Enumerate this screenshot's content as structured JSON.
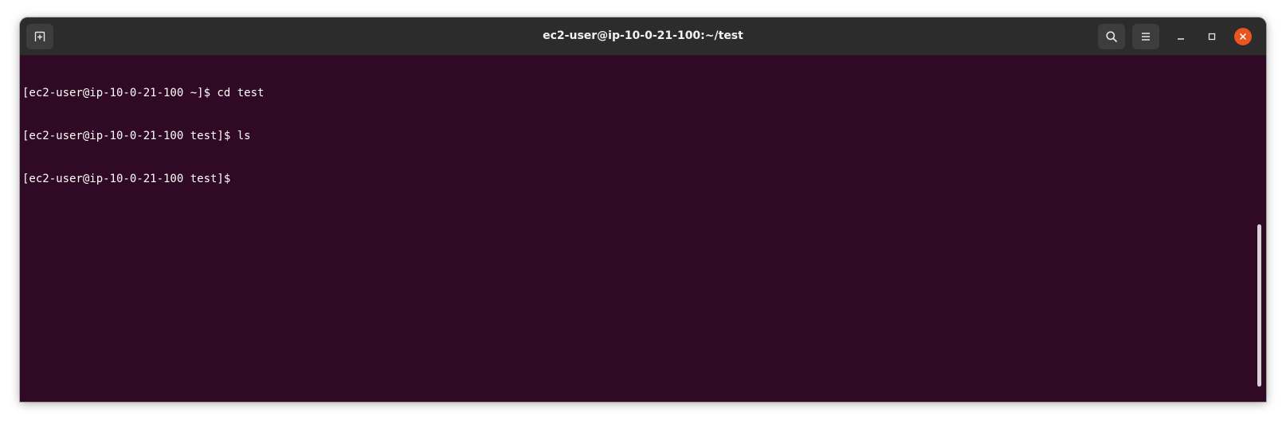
{
  "window": {
    "title": "ec2-user@ip-10-0-21-100:~/test"
  },
  "titlebar": {
    "new_tab_icon": "new-tab-icon",
    "search_icon": "search-icon",
    "menu_icon": "hamburger-menu-icon",
    "minimize_icon": "minimize-icon",
    "maximize_icon": "maximize-icon",
    "close_icon": "close-icon"
  },
  "terminal": {
    "lines": [
      "[ec2-user@ip-10-0-21-100 ~]$ cd test",
      "[ec2-user@ip-10-0-21-100 test]$ ls",
      "[ec2-user@ip-10-0-21-100 test]$"
    ]
  },
  "colors": {
    "terminal_background": "#300a24",
    "titlebar_background": "#2c2c2c",
    "close_button": "#e95420",
    "text": "#ffffff"
  }
}
